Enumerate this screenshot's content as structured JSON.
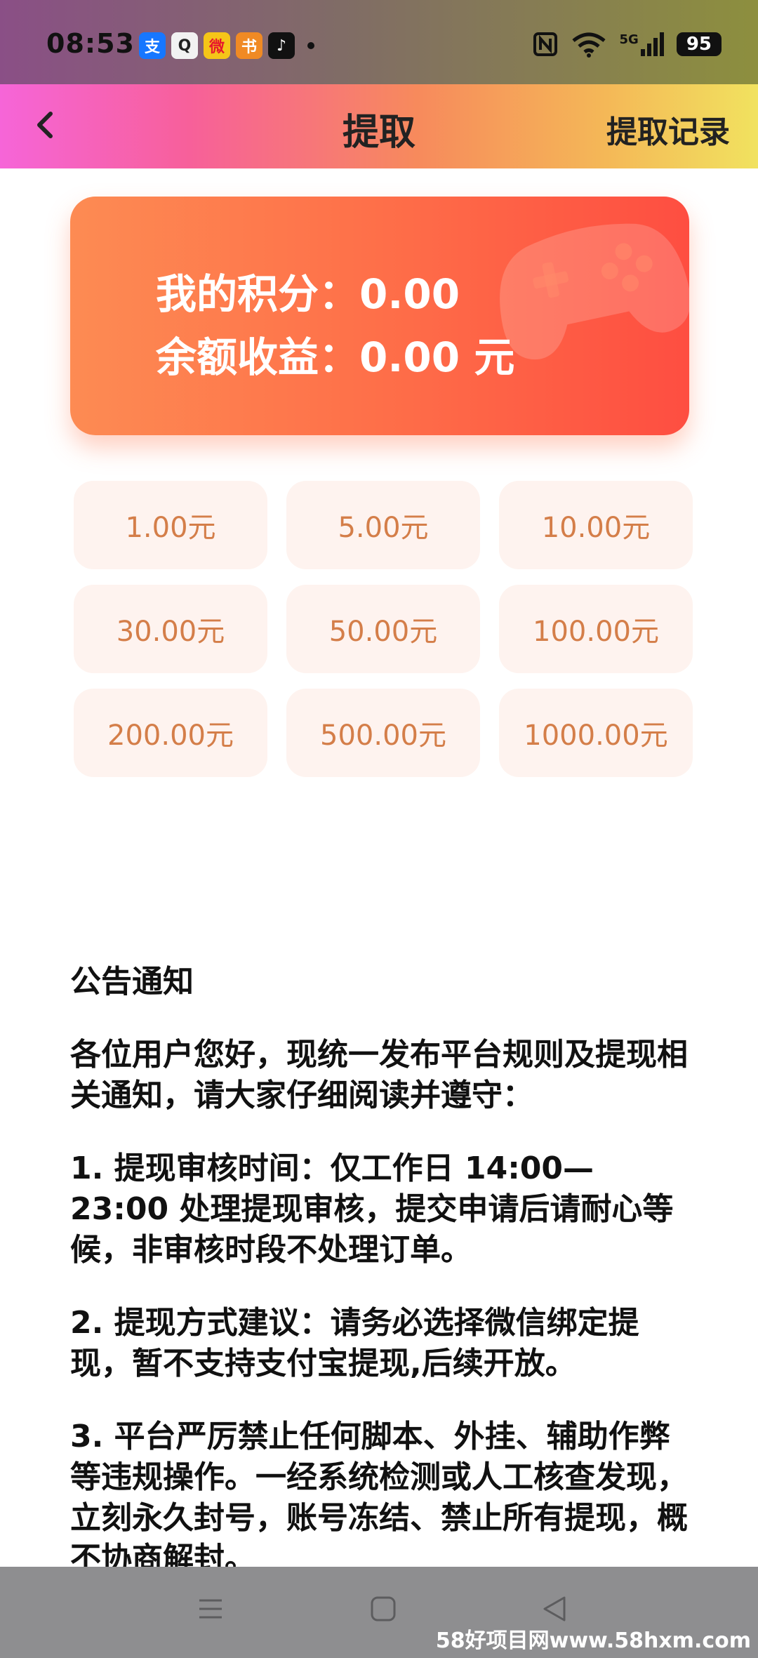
{
  "status_bar": {
    "time": "08:53",
    "apps": [
      {
        "icon": "alipay-icon",
        "glyph": "支",
        "color": "#1677ff"
      },
      {
        "icon": "qq-icon",
        "glyph": "Q",
        "color": "#222222"
      },
      {
        "icon": "weibo-icon",
        "glyph": "微",
        "color": "#e6162d"
      },
      {
        "icon": "books-icon",
        "glyph": "书",
        "color": "#f08a24"
      },
      {
        "icon": "tiktok-icon",
        "glyph": "♪",
        "color": "#111111"
      }
    ],
    "network": "5G",
    "battery": "95"
  },
  "header": {
    "title": "提取",
    "records_link": "提取记录"
  },
  "balance_card": {
    "points_label": "我的积分：",
    "points_value": "0.00",
    "earnings_label": "余额收益：",
    "earnings_value": "0.00",
    "earnings_unit": "元"
  },
  "amount_options": [
    "1.00元",
    "5.00元",
    "10.00元",
    "30.00元",
    "50.00元",
    "100.00元",
    "200.00元",
    "500.00元",
    "1000.00元"
  ],
  "notice": {
    "title": "公告通知",
    "intro": "各位用户您好，现统一发布平台规则及提现相关通知，请大家仔细阅读并遵守：",
    "item1": "1. 提现审核时间：仅工作日 14:00—23:00 处理提现审核，提交申请后请耐心等候，非审核时段不处理订单。",
    "item2": "2. 提现方式建议：请务必选择微信绑定提现，暂不支持支付宝提现,后续开放。",
    "item3": "3. 平台严厉禁止任何脚本、外挂、辅助作弊等违规操作。一经系统检测或人工核查发现，立刻永久封号，账号冻结、禁止所有提现，概不协商解封。"
  },
  "watermark": "58好项目网www.58hxm.com",
  "colors": {
    "card_start": "#fd8b53",
    "card_end": "#fe4e41",
    "amount_text": "#d47e49",
    "amount_bg": "#fef3ef"
  }
}
